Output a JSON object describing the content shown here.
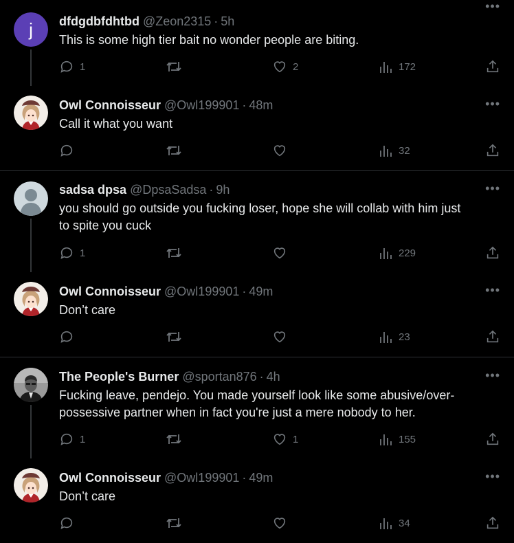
{
  "tweets": [
    {
      "name": "dfdgdbfdhtbd",
      "handle": "@Zeon2315",
      "time": "5h",
      "avatar": {
        "type": "letter",
        "letter": "j",
        "color": "#5b3fb5"
      },
      "lines": [
        "This is some high tier bait no wonder people are biting."
      ],
      "replies": "1",
      "retweets": "",
      "likes": "2",
      "views": "172"
    },
    {
      "name": "Owl Connoisseur",
      "handle": "@Owl199901",
      "time": "48m",
      "avatar": {
        "type": "anime"
      },
      "lines": [
        "Call it what you want"
      ],
      "replies": "",
      "retweets": "",
      "likes": "",
      "views": "32"
    },
    {
      "name": "sadsa dpsa",
      "handle": "@DpsaSadsa",
      "time": "9h",
      "avatar": {
        "type": "default"
      },
      "lines": [
        "you should go outside you fucking loser, hope she will collab with him just",
        "to spite you cuck"
      ],
      "replies": "1",
      "retweets": "",
      "likes": "",
      "views": "229"
    },
    {
      "name": "Owl Connoisseur",
      "handle": "@Owl199901",
      "time": "49m",
      "avatar": {
        "type": "anime"
      },
      "lines": [
        "Don’t care"
      ],
      "replies": "",
      "retweets": "",
      "likes": "",
      "views": "23"
    },
    {
      "name": "The People's Burner",
      "handle": "@sportan876",
      "time": "4h",
      "avatar": {
        "type": "photo"
      },
      "lines": [
        "Fucking leave, pendejo. You made yourself look like some abusive/over-",
        "possessive partner when in fact you're just a mere nobody to her."
      ],
      "replies": "1",
      "retweets": "",
      "likes": "1",
      "views": "155"
    },
    {
      "name": "Owl Connoisseur",
      "handle": "@Owl199901",
      "time": "49m",
      "avatar": {
        "type": "anime"
      },
      "lines": [
        "Don’t care"
      ],
      "replies": "",
      "retweets": "",
      "likes": "",
      "views": "34"
    }
  ],
  "ui": {
    "dot": "·",
    "more": "•••"
  },
  "colors": {
    "background": "#000000",
    "text": "#e7e9ea",
    "muted": "#71767b",
    "divider": "#2f3336"
  },
  "icons": [
    "reply-icon",
    "retweet-icon",
    "like-icon",
    "views-icon",
    "share-icon",
    "more-icon"
  ]
}
